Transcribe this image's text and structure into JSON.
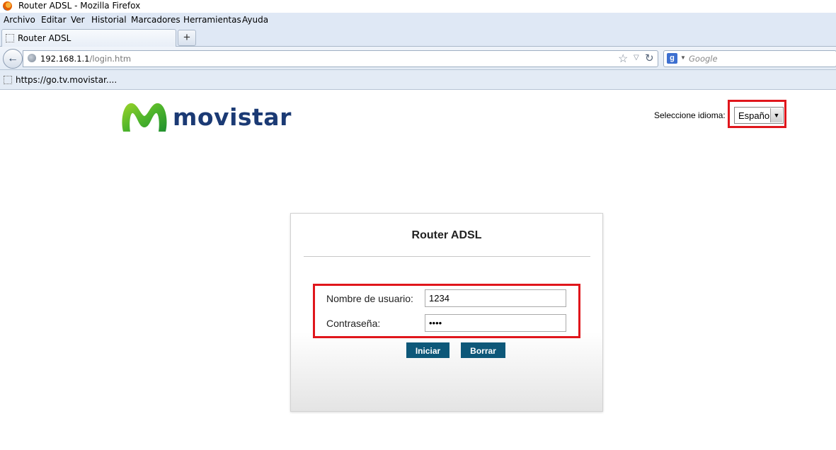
{
  "window": {
    "title": "Router ADSL - Mozilla Firefox"
  },
  "menu": [
    "Archivo",
    "Editar",
    "Ver",
    "Historial",
    "Marcadores",
    "Herramientas",
    "Ayuda"
  ],
  "tab": {
    "label": "Router ADSL",
    "new_tab": "+"
  },
  "nav": {
    "url_host": "192.168.1.1",
    "url_path": "/login.htm",
    "search_placeholder": "Google",
    "search_engine_letter": "g"
  },
  "bookmarks": [
    {
      "label": "https://go.tv.movistar...."
    }
  ],
  "page": {
    "brand": "movistar",
    "language_label": "Seleccione idioma:",
    "language_value": "Español",
    "highlight_color": "#e0161c",
    "brand_color": "#1b3a74",
    "button_color": "#0e5879"
  },
  "login": {
    "title": "Router ADSL",
    "username_label": "Nombre de usuario:",
    "username_value": "1234",
    "password_label": "Contraseña:",
    "password_value": "••••",
    "submit_label": "Iniciar",
    "reset_label": "Borrar"
  }
}
